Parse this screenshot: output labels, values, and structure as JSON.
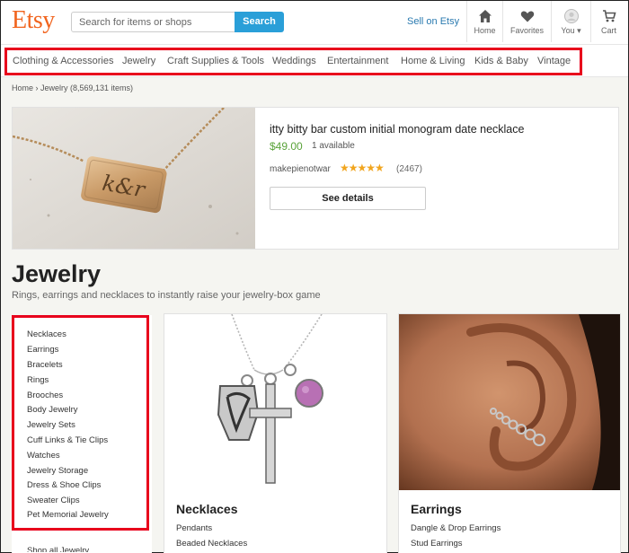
{
  "header": {
    "logo": "Etsy",
    "search_placeholder": "Search for items or shops",
    "search_button": "Search",
    "sell_link": "Sell on Etsy",
    "icons": [
      {
        "label": "Home",
        "icon": "home-icon"
      },
      {
        "label": "Favorites",
        "icon": "heart-icon"
      },
      {
        "label": "You ▾",
        "icon": "avatar-icon"
      },
      {
        "label": "Cart",
        "icon": "cart-icon"
      }
    ]
  },
  "categories": [
    "Clothing & Accessories",
    "Jewelry",
    "Craft Supplies & Tools",
    "Weddings",
    "Entertainment",
    "Home & Living",
    "Kids & Baby",
    "Vintage"
  ],
  "breadcrumb": "Home › Jewelry (8,569,131 items)",
  "featured": {
    "title": "itty bitty bar custom initial monogram date necklace",
    "price": "$49.00",
    "availability": "1 available",
    "shop": "makepienotwar",
    "stars": "★★★★★",
    "rating_value": 5,
    "reviews": "(2467)",
    "button": "See details",
    "pendant_text": "k&r"
  },
  "page": {
    "title": "Jewelry",
    "subtitle": "Rings, earrings and necklaces to instantly raise your jewelry-box game"
  },
  "sidebar": {
    "items": [
      "Necklaces",
      "Earrings",
      "Bracelets",
      "Rings",
      "Brooches",
      "Body Jewelry",
      "Jewelry Sets",
      "Cuff Links & Tie Clips",
      "Watches",
      "Jewelry Storage",
      "Dress & Shoe Clips",
      "Sweater Clips",
      "Pet Memorial Jewelry"
    ],
    "shop_all": "Shop all Jewelry"
  },
  "cards": [
    {
      "title": "Necklaces",
      "links": [
        "Pendants",
        "Beaded Necklaces"
      ]
    },
    {
      "title": "Earrings",
      "links": [
        "Dangle & Drop Earrings",
        "Stud Earrings"
      ]
    }
  ],
  "colors": {
    "brand": "#f1641e",
    "accent": "#2a9fd8",
    "price": "#5aa33a",
    "highlight": "#e8001c"
  }
}
